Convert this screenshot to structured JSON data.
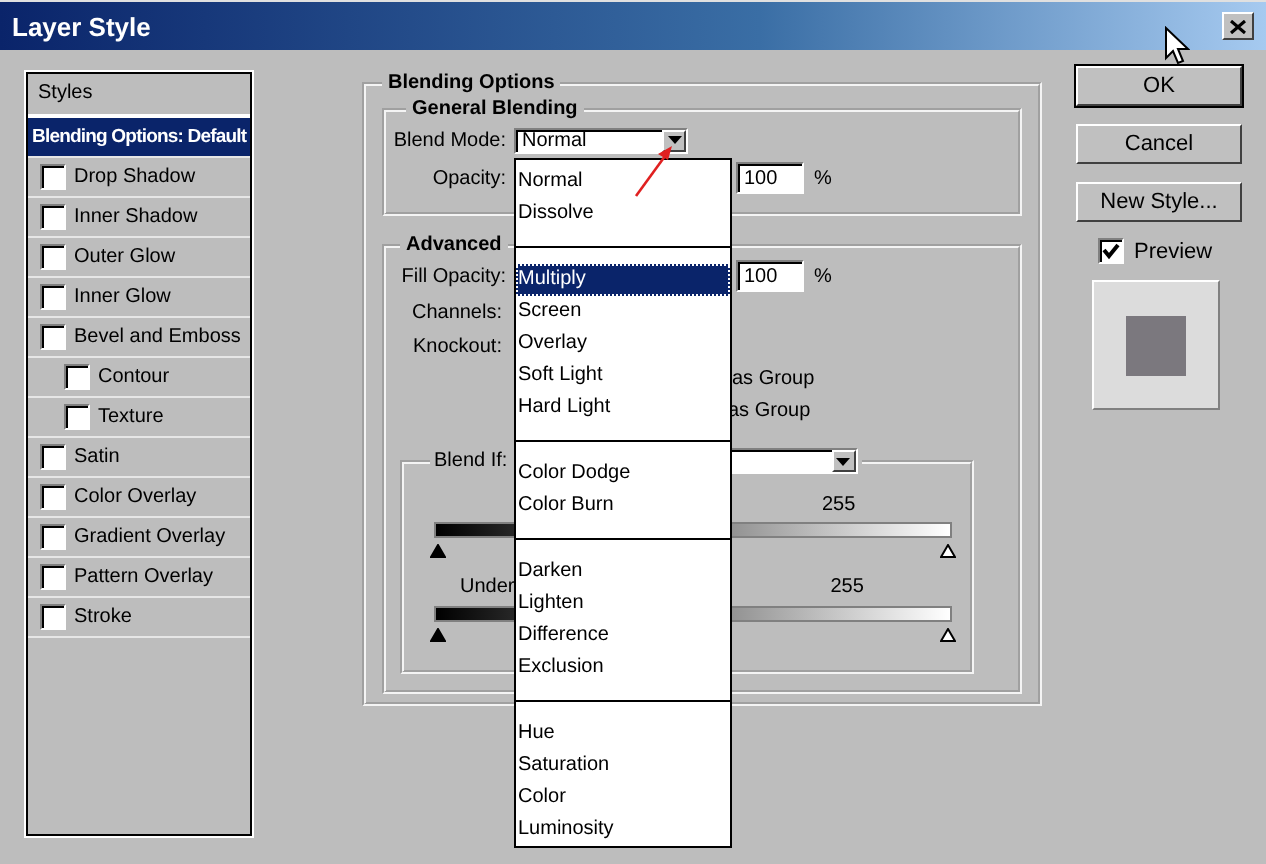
{
  "window": {
    "title": "Layer Style"
  },
  "styles_panel": {
    "header": "Styles",
    "items": [
      {
        "label": "Blending Options: Default",
        "kind": "heading",
        "selected": true
      },
      {
        "label": "Drop Shadow",
        "kind": "checkbox",
        "checked": false,
        "selected": false
      },
      {
        "label": "Inner Shadow",
        "kind": "checkbox",
        "checked": false,
        "selected": false
      },
      {
        "label": "Outer Glow",
        "kind": "checkbox",
        "checked": false,
        "selected": false
      },
      {
        "label": "Inner Glow",
        "kind": "checkbox",
        "checked": false,
        "selected": false
      },
      {
        "label": "Bevel and Emboss",
        "kind": "checkbox",
        "checked": false,
        "selected": false,
        "children": [
          {
            "label": "Contour",
            "kind": "checkbox",
            "checked": false,
            "selected": false
          },
          {
            "label": "Texture",
            "kind": "checkbox",
            "checked": false,
            "selected": false
          }
        ]
      },
      {
        "label": "Satin",
        "kind": "checkbox",
        "checked": false,
        "selected": false
      },
      {
        "label": "Color Overlay",
        "kind": "checkbox",
        "checked": false,
        "selected": false
      },
      {
        "label": "Gradient Overlay",
        "kind": "checkbox",
        "checked": false,
        "selected": false
      },
      {
        "label": "Pattern Overlay",
        "kind": "checkbox",
        "checked": false,
        "selected": false
      },
      {
        "label": "Stroke",
        "kind": "checkbox",
        "checked": false,
        "selected": false
      }
    ]
  },
  "blending_options": {
    "title": "Blending Options",
    "general": {
      "title": "General Blending",
      "blend_mode": {
        "label": "Blend Mode:",
        "value": "Normal"
      },
      "opacity": {
        "label": "Opacity:",
        "value": "100",
        "unit": "%"
      }
    },
    "advanced": {
      "title": "Advanced",
      "fill_opacity": {
        "label": "Fill Opacity:",
        "value": "100",
        "unit": "%"
      },
      "channels_label": "Channels:",
      "knockout_label": "Knockout:",
      "group_options": [
        "as Group",
        "as Group"
      ],
      "blend_if": {
        "label": "Blend If:",
        "this_layer_max": "255",
        "this_layer_slider": {
          "level": 1
        },
        "underlying_label": "Under",
        "underlying_max": "255",
        "underlying_slider": {
          "level": 1
        }
      }
    }
  },
  "dropdown": {
    "groups": [
      [
        {
          "label": "Normal",
          "selected": false
        },
        {
          "label": "Dissolve",
          "selected": false
        }
      ],
      [
        {
          "label": "Multiply",
          "selected": true
        },
        {
          "label": "Screen",
          "selected": false
        },
        {
          "label": "Overlay",
          "selected": false
        },
        {
          "label": "Soft Light",
          "selected": false
        },
        {
          "label": "Hard Light",
          "selected": false
        }
      ],
      [
        {
          "label": "Color Dodge",
          "selected": false
        },
        {
          "label": "Color Burn",
          "selected": false
        }
      ],
      [
        {
          "label": "Darken",
          "selected": false
        },
        {
          "label": "Lighten",
          "selected": false
        },
        {
          "label": "Difference",
          "selected": false
        },
        {
          "label": "Exclusion",
          "selected": false
        }
      ],
      [
        {
          "label": "Hue",
          "selected": false
        },
        {
          "label": "Saturation",
          "selected": false
        },
        {
          "label": "Color",
          "selected": false
        },
        {
          "label": "Luminosity",
          "selected": false
        }
      ]
    ]
  },
  "buttons": [
    {
      "label": "OK",
      "default": true
    },
    {
      "label": "Cancel",
      "default": false
    },
    {
      "label": "New Style...",
      "default": false
    }
  ],
  "preview": {
    "label": "Preview",
    "checked": true
  }
}
